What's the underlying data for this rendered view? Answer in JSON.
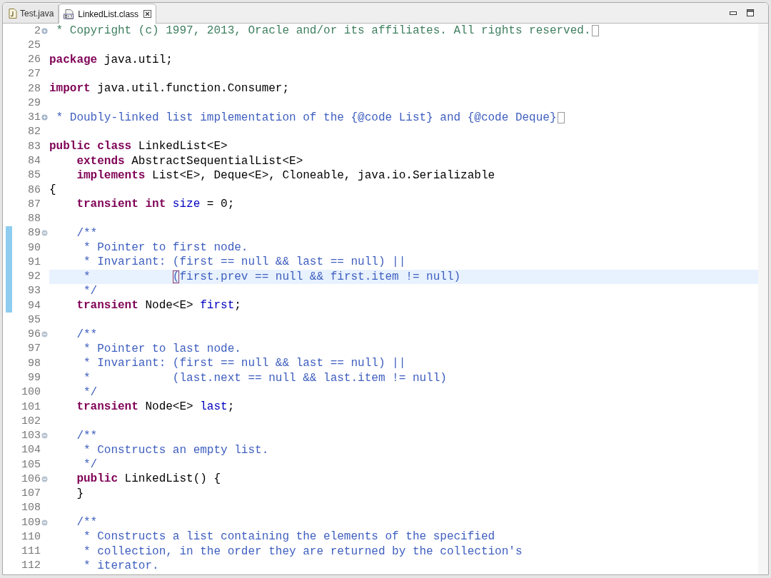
{
  "tabs": [
    {
      "label": "Test.java",
      "kind": "java",
      "selected": false
    },
    {
      "label": "LinkedList.class",
      "kind": "class",
      "selected": true
    }
  ],
  "editor": {
    "lines": [
      {
        "number": "2",
        "collapsed": true,
        "changed": false,
        "current": false,
        "tokens": [
          {
            "kind": "comment",
            "text": " * Copyright (c) 1997, 2013, Oracle and/or its affiliates. All rights reserved."
          }
        ]
      },
      {
        "number": "25",
        "changed": false,
        "current": false
      },
      {
        "number": "26",
        "changed": false,
        "current": false,
        "tokens": [
          {
            "kind": "keyword",
            "text": "package"
          },
          {
            "kind": "plain",
            "text": " java.util;"
          }
        ]
      },
      {
        "number": "27",
        "changed": false,
        "current": false
      },
      {
        "number": "28",
        "changed": false,
        "current": false,
        "tokens": [
          {
            "kind": "keyword",
            "text": "import"
          },
          {
            "kind": "plain",
            "text": " java.util.function.Consumer;"
          }
        ]
      },
      {
        "number": "29",
        "changed": false,
        "current": false
      },
      {
        "number": "31",
        "collapsed": true,
        "changed": false,
        "current": false,
        "tokens": [
          {
            "kind": "doc",
            "text": " * Doubly-linked list implementation of the {@code List} and {@code Deque}"
          }
        ]
      },
      {
        "number": "82",
        "changed": false,
        "current": false
      },
      {
        "number": "83",
        "changed": false,
        "current": false,
        "tokens": [
          {
            "kind": "keyword",
            "text": "public class"
          },
          {
            "kind": "plain",
            "text": " LinkedList<E>"
          }
        ]
      },
      {
        "number": "84",
        "changed": false,
        "current": false,
        "tokens": [
          {
            "kind": "keyword",
            "text": "    extends"
          },
          {
            "kind": "plain",
            "text": " AbstractSequentialList<E>"
          }
        ]
      },
      {
        "number": "85",
        "changed": false,
        "current": false,
        "tokens": [
          {
            "kind": "keyword",
            "text": "    implements"
          },
          {
            "kind": "plain",
            "text": " List<E>, Deque<E>, Cloneable, java.io.Serializable"
          }
        ]
      },
      {
        "number": "86",
        "changed": false,
        "current": false,
        "tokens": [
          {
            "kind": "plain",
            "text": "{"
          }
        ]
      },
      {
        "number": "87",
        "changed": false,
        "current": false,
        "tokens": [
          {
            "kind": "keyword",
            "text": "    transient int"
          },
          {
            "kind": "field",
            "text": " size"
          },
          {
            "kind": "plain",
            "text": " = 0;"
          }
        ]
      },
      {
        "number": "88",
        "changed": false,
        "current": false
      },
      {
        "number": "89",
        "collapsed": false,
        "changed": true,
        "current": false,
        "tokens": [
          {
            "kind": "doc",
            "text": "    /**"
          }
        ]
      },
      {
        "number": "90",
        "changed": true,
        "current": false,
        "tokens": [
          {
            "kind": "doc",
            "text": "     * Pointer to first node."
          }
        ]
      },
      {
        "number": "91",
        "changed": true,
        "current": false,
        "tokens": [
          {
            "kind": "doc",
            "text": "     * Invariant: (first == null && last == null) ||"
          }
        ]
      },
      {
        "number": "92",
        "changed": true,
        "current": true,
        "tokens": [
          {
            "kind": "doc",
            "text": "     *            "
          },
          {
            "kind": "bracket",
            "text": "("
          },
          {
            "kind": "doc",
            "text": "first.prev == null && first.item != null)"
          }
        ]
      },
      {
        "number": "93",
        "changed": true,
        "current": false,
        "tokens": [
          {
            "kind": "doc",
            "text": "     */"
          }
        ]
      },
      {
        "number": "94",
        "changed": true,
        "current": false,
        "tokens": [
          {
            "kind": "keyword",
            "text": "    transient"
          },
          {
            "kind": "plain",
            "text": " Node<E>"
          },
          {
            "kind": "field",
            "text": " first"
          },
          {
            "kind": "plain",
            "text": ";"
          }
        ]
      },
      {
        "number": "95",
        "changed": false,
        "current": false
      },
      {
        "number": "96",
        "collapsed": false,
        "changed": false,
        "current": false,
        "tokens": [
          {
            "kind": "doc",
            "text": "    /**"
          }
        ]
      },
      {
        "number": "97",
        "changed": false,
        "current": false,
        "tokens": [
          {
            "kind": "doc",
            "text": "     * Pointer to last node."
          }
        ]
      },
      {
        "number": "98",
        "changed": false,
        "current": false,
        "tokens": [
          {
            "kind": "doc",
            "text": "     * Invariant: (first == null && last == null) ||"
          }
        ]
      },
      {
        "number": "99",
        "changed": false,
        "current": false,
        "tokens": [
          {
            "kind": "doc",
            "text": "     *            (last.next == null && last.item != null)"
          }
        ]
      },
      {
        "number": "100",
        "changed": false,
        "current": false,
        "tokens": [
          {
            "kind": "doc",
            "text": "     */"
          }
        ]
      },
      {
        "number": "101",
        "changed": false,
        "current": false,
        "tokens": [
          {
            "kind": "keyword",
            "text": "    transient"
          },
          {
            "kind": "plain",
            "text": " Node<E>"
          },
          {
            "kind": "field",
            "text": " last"
          },
          {
            "kind": "plain",
            "text": ";"
          }
        ]
      },
      {
        "number": "102",
        "changed": false,
        "current": false
      },
      {
        "number": "103",
        "collapsed": false,
        "changed": false,
        "current": false,
        "tokens": [
          {
            "kind": "doc",
            "text": "    /**"
          }
        ]
      },
      {
        "number": "104",
        "changed": false,
        "current": false,
        "tokens": [
          {
            "kind": "doc",
            "text": "     * Constructs an empty list."
          }
        ]
      },
      {
        "number": "105",
        "changed": false,
        "current": false,
        "tokens": [
          {
            "kind": "doc",
            "text": "     */"
          }
        ]
      },
      {
        "number": "106",
        "collapsed": false,
        "changed": false,
        "current": false,
        "tokens": [
          {
            "kind": "keyword",
            "text": "    public"
          },
          {
            "kind": "plain",
            "text": " LinkedList() {"
          }
        ]
      },
      {
        "number": "107",
        "changed": false,
        "current": false,
        "tokens": [
          {
            "kind": "plain",
            "text": "    }"
          }
        ]
      },
      {
        "number": "108",
        "changed": false,
        "current": false
      },
      {
        "number": "109",
        "collapsed": false,
        "changed": false,
        "current": false,
        "tokens": [
          {
            "kind": "doc",
            "text": "    /**"
          }
        ]
      },
      {
        "number": "110",
        "changed": false,
        "current": false,
        "tokens": [
          {
            "kind": "doc",
            "text": "     * Constructs a list containing the elements of the specified"
          }
        ]
      },
      {
        "number": "111",
        "changed": false,
        "current": false,
        "tokens": [
          {
            "kind": "doc",
            "text": "     * collection, in the order they are returned by the collection's"
          }
        ]
      },
      {
        "number": "112",
        "changed": false,
        "current": false,
        "tokens": [
          {
            "kind": "doc",
            "text": "     * iterator."
          }
        ]
      }
    ]
  }
}
